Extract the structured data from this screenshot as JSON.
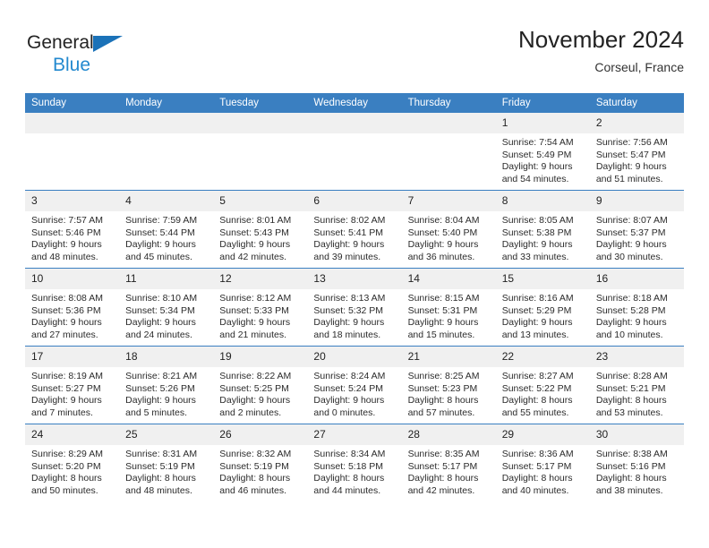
{
  "brand": {
    "name_dark": "General",
    "name_blue": "Blue",
    "triangle_icon": "triangle-icon",
    "accent_dark": "#232323",
    "accent_blue": "#2389cf",
    "triangle_color": "#1b72b8"
  },
  "header": {
    "title": "November 2024",
    "subtitle": "Corseul, France"
  },
  "theme": {
    "header_bg": "#3a7fc1",
    "header_text": "#ffffff",
    "daynum_bg": "#f0f0f0",
    "cell_bg": "#ffffff",
    "row_border": "#3a7fc1"
  },
  "calendar": {
    "weekday_headers": [
      "Sunday",
      "Monday",
      "Tuesday",
      "Wednesday",
      "Thursday",
      "Friday",
      "Saturday"
    ],
    "weeks": [
      [
        {
          "day": "",
          "empty": true,
          "sunrise": "",
          "sunset": "",
          "daylight_line1": "",
          "daylight_line2": ""
        },
        {
          "day": "",
          "empty": true,
          "sunrise": "",
          "sunset": "",
          "daylight_line1": "",
          "daylight_line2": ""
        },
        {
          "day": "",
          "empty": true,
          "sunrise": "",
          "sunset": "",
          "daylight_line1": "",
          "daylight_line2": ""
        },
        {
          "day": "",
          "empty": true,
          "sunrise": "",
          "sunset": "",
          "daylight_line1": "",
          "daylight_line2": ""
        },
        {
          "day": "",
          "empty": true,
          "sunrise": "",
          "sunset": "",
          "daylight_line1": "",
          "daylight_line2": ""
        },
        {
          "day": "1",
          "empty": false,
          "sunrise": "Sunrise: 7:54 AM",
          "sunset": "Sunset: 5:49 PM",
          "daylight_line1": "Daylight: 9 hours",
          "daylight_line2": "and 54 minutes."
        },
        {
          "day": "2",
          "empty": false,
          "sunrise": "Sunrise: 7:56 AM",
          "sunset": "Sunset: 5:47 PM",
          "daylight_line1": "Daylight: 9 hours",
          "daylight_line2": "and 51 minutes."
        }
      ],
      [
        {
          "day": "3",
          "empty": false,
          "sunrise": "Sunrise: 7:57 AM",
          "sunset": "Sunset: 5:46 PM",
          "daylight_line1": "Daylight: 9 hours",
          "daylight_line2": "and 48 minutes."
        },
        {
          "day": "4",
          "empty": false,
          "sunrise": "Sunrise: 7:59 AM",
          "sunset": "Sunset: 5:44 PM",
          "daylight_line1": "Daylight: 9 hours",
          "daylight_line2": "and 45 minutes."
        },
        {
          "day": "5",
          "empty": false,
          "sunrise": "Sunrise: 8:01 AM",
          "sunset": "Sunset: 5:43 PM",
          "daylight_line1": "Daylight: 9 hours",
          "daylight_line2": "and 42 minutes."
        },
        {
          "day": "6",
          "empty": false,
          "sunrise": "Sunrise: 8:02 AM",
          "sunset": "Sunset: 5:41 PM",
          "daylight_line1": "Daylight: 9 hours",
          "daylight_line2": "and 39 minutes."
        },
        {
          "day": "7",
          "empty": false,
          "sunrise": "Sunrise: 8:04 AM",
          "sunset": "Sunset: 5:40 PM",
          "daylight_line1": "Daylight: 9 hours",
          "daylight_line2": "and 36 minutes."
        },
        {
          "day": "8",
          "empty": false,
          "sunrise": "Sunrise: 8:05 AM",
          "sunset": "Sunset: 5:38 PM",
          "daylight_line1": "Daylight: 9 hours",
          "daylight_line2": "and 33 minutes."
        },
        {
          "day": "9",
          "empty": false,
          "sunrise": "Sunrise: 8:07 AM",
          "sunset": "Sunset: 5:37 PM",
          "daylight_line1": "Daylight: 9 hours",
          "daylight_line2": "and 30 minutes."
        }
      ],
      [
        {
          "day": "10",
          "empty": false,
          "sunrise": "Sunrise: 8:08 AM",
          "sunset": "Sunset: 5:36 PM",
          "daylight_line1": "Daylight: 9 hours",
          "daylight_line2": "and 27 minutes."
        },
        {
          "day": "11",
          "empty": false,
          "sunrise": "Sunrise: 8:10 AM",
          "sunset": "Sunset: 5:34 PM",
          "daylight_line1": "Daylight: 9 hours",
          "daylight_line2": "and 24 minutes."
        },
        {
          "day": "12",
          "empty": false,
          "sunrise": "Sunrise: 8:12 AM",
          "sunset": "Sunset: 5:33 PM",
          "daylight_line1": "Daylight: 9 hours",
          "daylight_line2": "and 21 minutes."
        },
        {
          "day": "13",
          "empty": false,
          "sunrise": "Sunrise: 8:13 AM",
          "sunset": "Sunset: 5:32 PM",
          "daylight_line1": "Daylight: 9 hours",
          "daylight_line2": "and 18 minutes."
        },
        {
          "day": "14",
          "empty": false,
          "sunrise": "Sunrise: 8:15 AM",
          "sunset": "Sunset: 5:31 PM",
          "daylight_line1": "Daylight: 9 hours",
          "daylight_line2": "and 15 minutes."
        },
        {
          "day": "15",
          "empty": false,
          "sunrise": "Sunrise: 8:16 AM",
          "sunset": "Sunset: 5:29 PM",
          "daylight_line1": "Daylight: 9 hours",
          "daylight_line2": "and 13 minutes."
        },
        {
          "day": "16",
          "empty": false,
          "sunrise": "Sunrise: 8:18 AM",
          "sunset": "Sunset: 5:28 PM",
          "daylight_line1": "Daylight: 9 hours",
          "daylight_line2": "and 10 minutes."
        }
      ],
      [
        {
          "day": "17",
          "empty": false,
          "sunrise": "Sunrise: 8:19 AM",
          "sunset": "Sunset: 5:27 PM",
          "daylight_line1": "Daylight: 9 hours",
          "daylight_line2": "and 7 minutes."
        },
        {
          "day": "18",
          "empty": false,
          "sunrise": "Sunrise: 8:21 AM",
          "sunset": "Sunset: 5:26 PM",
          "daylight_line1": "Daylight: 9 hours",
          "daylight_line2": "and 5 minutes."
        },
        {
          "day": "19",
          "empty": false,
          "sunrise": "Sunrise: 8:22 AM",
          "sunset": "Sunset: 5:25 PM",
          "daylight_line1": "Daylight: 9 hours",
          "daylight_line2": "and 2 minutes."
        },
        {
          "day": "20",
          "empty": false,
          "sunrise": "Sunrise: 8:24 AM",
          "sunset": "Sunset: 5:24 PM",
          "daylight_line1": "Daylight: 9 hours",
          "daylight_line2": "and 0 minutes."
        },
        {
          "day": "21",
          "empty": false,
          "sunrise": "Sunrise: 8:25 AM",
          "sunset": "Sunset: 5:23 PM",
          "daylight_line1": "Daylight: 8 hours",
          "daylight_line2": "and 57 minutes."
        },
        {
          "day": "22",
          "empty": false,
          "sunrise": "Sunrise: 8:27 AM",
          "sunset": "Sunset: 5:22 PM",
          "daylight_line1": "Daylight: 8 hours",
          "daylight_line2": "and 55 minutes."
        },
        {
          "day": "23",
          "empty": false,
          "sunrise": "Sunrise: 8:28 AM",
          "sunset": "Sunset: 5:21 PM",
          "daylight_line1": "Daylight: 8 hours",
          "daylight_line2": "and 53 minutes."
        }
      ],
      [
        {
          "day": "24",
          "empty": false,
          "sunrise": "Sunrise: 8:29 AM",
          "sunset": "Sunset: 5:20 PM",
          "daylight_line1": "Daylight: 8 hours",
          "daylight_line2": "and 50 minutes."
        },
        {
          "day": "25",
          "empty": false,
          "sunrise": "Sunrise: 8:31 AM",
          "sunset": "Sunset: 5:19 PM",
          "daylight_line1": "Daylight: 8 hours",
          "daylight_line2": "and 48 minutes."
        },
        {
          "day": "26",
          "empty": false,
          "sunrise": "Sunrise: 8:32 AM",
          "sunset": "Sunset: 5:19 PM",
          "daylight_line1": "Daylight: 8 hours",
          "daylight_line2": "and 46 minutes."
        },
        {
          "day": "27",
          "empty": false,
          "sunrise": "Sunrise: 8:34 AM",
          "sunset": "Sunset: 5:18 PM",
          "daylight_line1": "Daylight: 8 hours",
          "daylight_line2": "and 44 minutes."
        },
        {
          "day": "28",
          "empty": false,
          "sunrise": "Sunrise: 8:35 AM",
          "sunset": "Sunset: 5:17 PM",
          "daylight_line1": "Daylight: 8 hours",
          "daylight_line2": "and 42 minutes."
        },
        {
          "day": "29",
          "empty": false,
          "sunrise": "Sunrise: 8:36 AM",
          "sunset": "Sunset: 5:17 PM",
          "daylight_line1": "Daylight: 8 hours",
          "daylight_line2": "and 40 minutes."
        },
        {
          "day": "30",
          "empty": false,
          "sunrise": "Sunrise: 8:38 AM",
          "sunset": "Sunset: 5:16 PM",
          "daylight_line1": "Daylight: 8 hours",
          "daylight_line2": "and 38 minutes."
        }
      ]
    ]
  }
}
